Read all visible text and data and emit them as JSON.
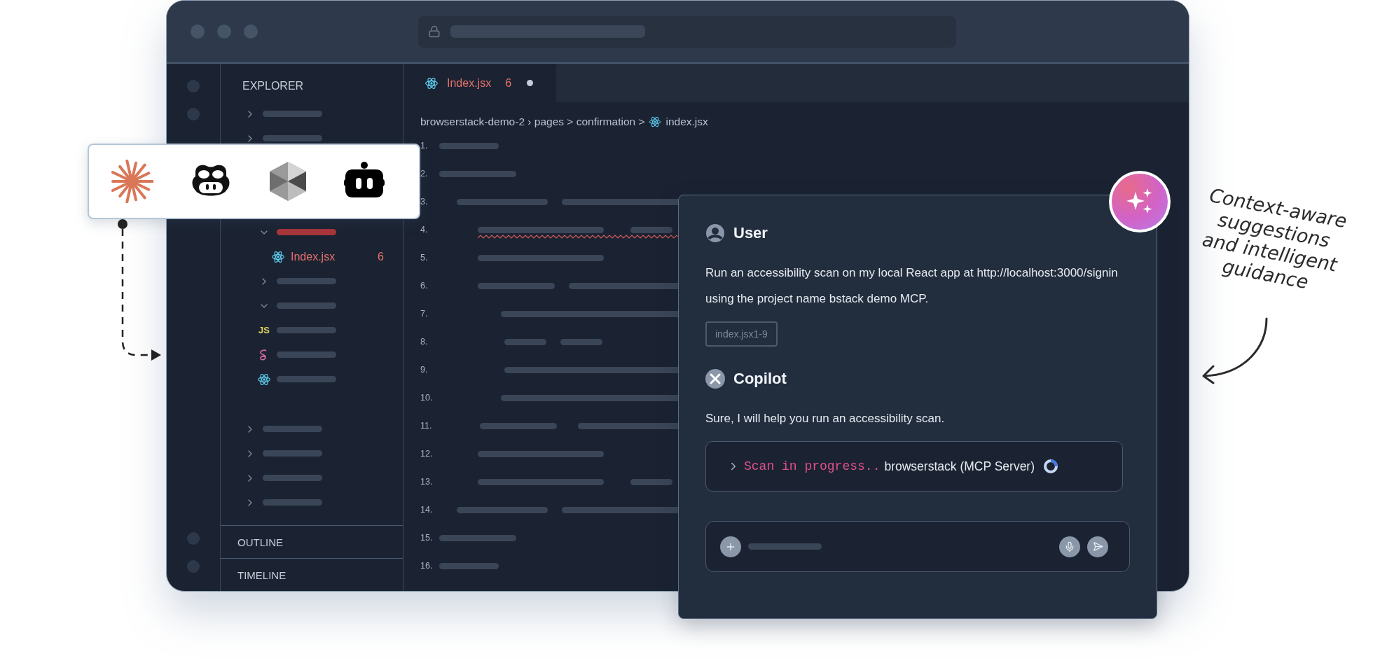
{
  "explorer": {
    "title": "EXPLORER",
    "tree_top": [
      {
        "kind": "folder",
        "expanded": false
      },
      {
        "kind": "folder",
        "expanded": false
      }
    ],
    "tree_nested": [
      {
        "kind": "folder",
        "expanded": true,
        "error": true,
        "children": [
          {
            "kind": "react",
            "label": "Index.jsx",
            "badge": "6",
            "error": true
          }
        ]
      },
      {
        "kind": "folder",
        "expanded": false,
        "error": false
      },
      {
        "kind": "folder",
        "expanded": true,
        "error": false
      },
      {
        "kind": "js",
        "icon_text": "JS"
      },
      {
        "kind": "sass"
      },
      {
        "kind": "react"
      }
    ],
    "tree_bottom": [
      {
        "kind": "folder",
        "expanded": false
      },
      {
        "kind": "folder",
        "expanded": false
      },
      {
        "kind": "folder",
        "expanded": false
      },
      {
        "kind": "folder",
        "expanded": false
      }
    ],
    "sections": [
      "OUTLINE",
      "TIMELINE"
    ]
  },
  "editor": {
    "tabs": [
      {
        "label": "Index.jsx",
        "badge": "6",
        "modified": true,
        "selected": true
      }
    ],
    "breadcrumb": {
      "path": "browserstack-demo-2 › pages > confirmation >",
      "file": "index.jsx"
    },
    "lines": [
      {
        "number": "1.",
        "error": false
      },
      {
        "number": "2.",
        "error": false
      },
      {
        "number": "3.",
        "error": false
      },
      {
        "number": "4.",
        "error": true
      },
      {
        "number": "5.",
        "error": false
      },
      {
        "number": "6.",
        "error": false
      },
      {
        "number": "7.",
        "error": false
      },
      {
        "number": "8.",
        "error": false
      },
      {
        "number": "9.",
        "error": false
      },
      {
        "number": "10.",
        "error": false
      },
      {
        "number": "11.",
        "error": false
      },
      {
        "number": "12.",
        "error": false
      },
      {
        "number": "13.",
        "error": false
      },
      {
        "number": "14.",
        "error": false
      },
      {
        "number": "15.",
        "error": false
      },
      {
        "number": "16.",
        "error": false
      }
    ]
  },
  "chat": {
    "messages": [
      {
        "kind": "user",
        "author": "User",
        "text": "Run an accessibility scan on my local React app at http://localhost:3000/signin using the project name bstack demo MCP.",
        "attachment": "index.jsx1-9"
      },
      {
        "kind": "assistant",
        "author": "Copilot",
        "text": "Sure, I will help you run an accessibility scan.",
        "tool_call": {
          "status": "Scan in progress..",
          "server": "browserstack (MCP Server)",
          "running": true
        }
      }
    ]
  },
  "tool_logos": [
    {
      "kind": "starburst"
    },
    {
      "kind": "goggles"
    },
    {
      "kind": "cube"
    },
    {
      "kind": "robot"
    }
  ],
  "annotation": {
    "lines": [
      "Context-aware",
      "suggestions",
      "and intelligent",
      "guidance"
    ]
  }
}
